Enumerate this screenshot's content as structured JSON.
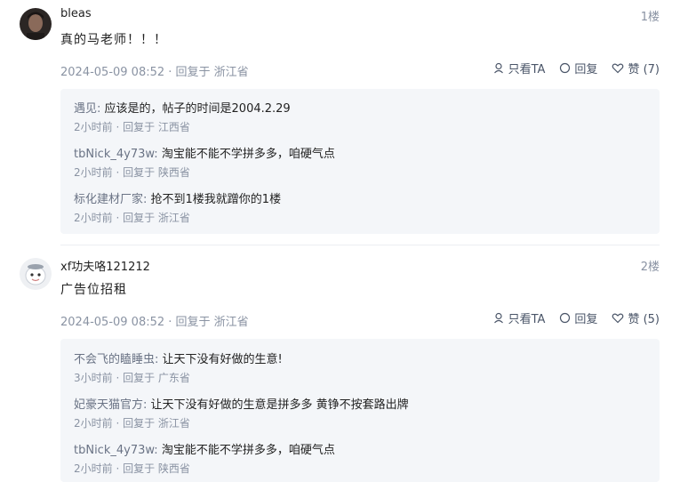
{
  "posts": [
    {
      "username": "bleas",
      "floor": "1楼",
      "content": "真的马老师！！！",
      "meta": "2024-05-09 08:52 · 回复于 浙江省",
      "actions": {
        "only_view": "只看TA",
        "reply": "回复",
        "like": "赞 (7)"
      },
      "replies": [
        {
          "author": "遇见:",
          "text": "应该是的，帖子的时间是2004.2.29",
          "meta": "2小时前 · 回复于 江西省"
        },
        {
          "author": "tbNick_4y73w:",
          "text": "淘宝能不能不学拼多多，咱硬气点",
          "meta": "2小时前 · 回复于 陕西省"
        },
        {
          "author": "标化建材厂家:",
          "text": "抢不到1楼我就蹭你的1楼",
          "meta": "2小时前 · 回复于 浙江省"
        }
      ]
    },
    {
      "username": "xf功夫咯121212",
      "floor": "2楼",
      "content": "广告位招租",
      "meta": "2024-05-09 08:52 · 回复于 浙江省",
      "actions": {
        "only_view": "只看TA",
        "reply": "回复",
        "like": "赞 (5)"
      },
      "replies": [
        {
          "author": "不会飞的瞌睡虫:",
          "text": "让天下没有好做的生意!",
          "meta": "3小时前 · 回复于 广东省"
        },
        {
          "author": "妃豪天猫官方:",
          "text": "让天下没有好做的生意是拼多多 黄铮不按套路出牌",
          "meta": "2小时前 · 回复于 浙江省"
        },
        {
          "author": "tbNick_4y73w:",
          "text": "淘宝能不能不学拼多多，咱硬气点",
          "meta": "2小时前 · 回复于 陕西省"
        }
      ]
    }
  ]
}
